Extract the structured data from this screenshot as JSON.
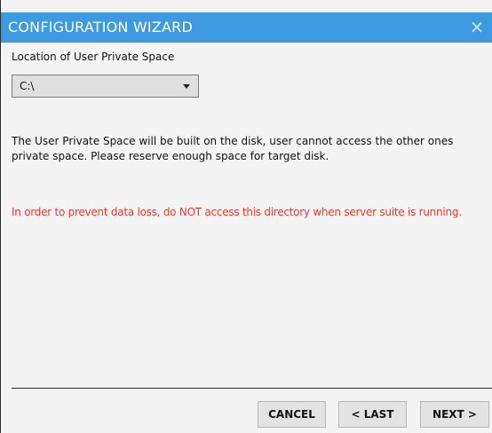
{
  "window": {
    "title": "CONFIGURATION WIZARD",
    "close_glyph": "×",
    "title_bar_color": "#3e9ae0"
  },
  "location": {
    "label": "Location of User Private Space",
    "selected_value": "C:\\",
    "arrow_icon": "chevron-down-icon"
  },
  "info": {
    "text": "The User Private Space will be built on the disk, user cannot access the other ones private space. Please reserve enough space for target disk."
  },
  "warning": {
    "text": "In order to prevent data loss, do NOT access this directory when server suite is running.",
    "color": "#e8382d"
  },
  "buttons": {
    "cancel": "CANCEL",
    "last": "< LAST",
    "next": "NEXT >"
  }
}
